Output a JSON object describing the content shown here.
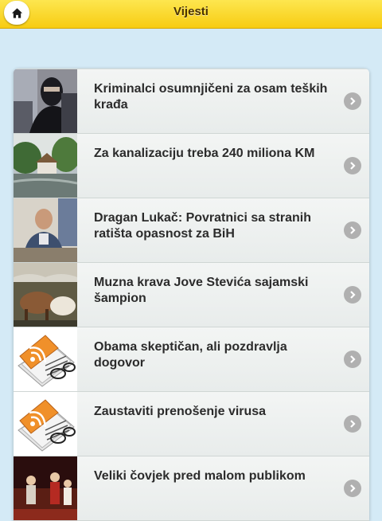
{
  "header": {
    "title": "Vijesti",
    "home_icon": "home-icon"
  },
  "news": [
    {
      "title": "Kriminalci osumnjičeni za osam teških krađa",
      "thumb": "masked-robber-photo"
    },
    {
      "title": "Za kanalizaciju treba 240 miliona KM",
      "thumb": "flooded-village-photo"
    },
    {
      "title": "Dragan Lukač: Povratnici sa stranih ratišta opasnost za BiH",
      "thumb": "police-officer-photo"
    },
    {
      "title": "Muzna krava Jove Stevića sajamski šampion",
      "thumb": "cattle-fair-photo"
    },
    {
      "title": "Obama skeptičan, ali pozdravlja dogovor",
      "thumb": "rss-newspaper-icon"
    },
    {
      "title": "Zaustaviti prenošenje virusa",
      "thumb": "rss-newspaper-icon"
    },
    {
      "title": "Veliki čovjek pred malom publikom",
      "thumb": "stage-performance-photo"
    }
  ],
  "colors": {
    "header": "#f9d52a",
    "background": "#d4eaf6",
    "chevron": "#b0b0b0"
  }
}
